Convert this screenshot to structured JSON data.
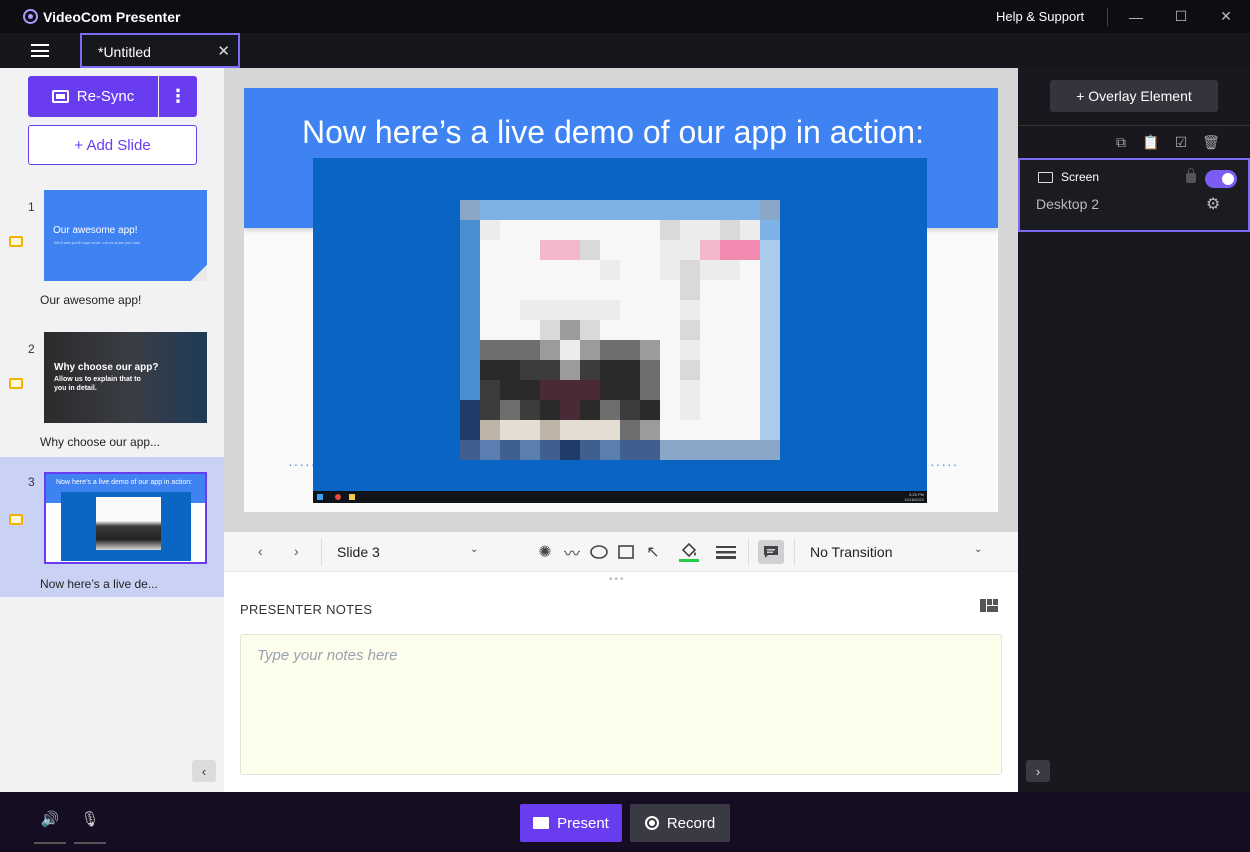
{
  "app": {
    "title": "VideoCom Presenter",
    "help": "Help & Support"
  },
  "window": {
    "minimize": "—",
    "maximize": "☐",
    "close": "✕"
  },
  "tab": {
    "label": "*Untitled",
    "close": "✕"
  },
  "left": {
    "resync_label": "Re-Sync",
    "more_label": "⋮",
    "add_slide_label": "+ Add Slide",
    "collapse": "‹"
  },
  "slides": [
    {
      "number": "1",
      "caption": "Our awesome app!",
      "thumb_title": "Our awesome app!",
      "thumb_sub": "We'll and you'll hope soon. Let us show you how."
    },
    {
      "number": "2",
      "caption": "Why choose our app...",
      "thumb_title": "Why choose our app?",
      "thumb_sub": "Allow us to explain that to you in detail."
    },
    {
      "number": "3",
      "caption": "Now here’s a live de...",
      "thumb_title": "Now here’s a live demo of our app in action:"
    }
  ],
  "stage": {
    "title": "Now here’s a live demo of our app in action:",
    "left_dots": "·····",
    "right_dots": "·····",
    "clock": "5:26 PM\n11/16/2022"
  },
  "toolbar": {
    "prev": "‹",
    "next": "›",
    "slide_select": "Slide 3",
    "caret": "⌄",
    "transition": "No Transition"
  },
  "notes": {
    "label": "PRESENTER NOTES",
    "placeholder": "Type your notes here",
    "value": ""
  },
  "right": {
    "overlay_label": "+ Overlay Element",
    "layer_title": "Screen",
    "layer_source": "Desktop 2",
    "layer_enabled": true,
    "expand": "›"
  },
  "bottom": {
    "present_label": "Present",
    "record_label": "Record"
  },
  "colors": {
    "accent": "#6a3cf0",
    "slide_blue": "#3f83f3",
    "notes_bg": "#fefeec"
  }
}
